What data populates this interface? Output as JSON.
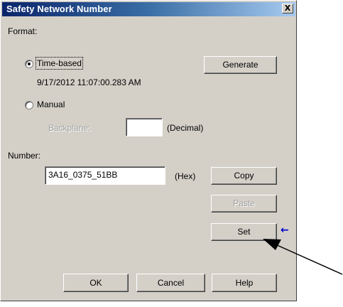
{
  "dialog": {
    "title": "Safety Network Number",
    "close_glyph": "X"
  },
  "format": {
    "group_label": "Format:",
    "time_based": {
      "label": "Time-based",
      "selected": true,
      "timestamp": "9/17/2012 11:07:00.283 AM"
    },
    "manual": {
      "label": "Manual",
      "selected": false,
      "backplane_label": "Backplane:",
      "backplane_value": "",
      "decimal_label": "(Decimal)"
    },
    "generate_label": "Generate"
  },
  "number": {
    "label": "Number:",
    "value": "3A16_0375_51BB",
    "hex_label": "(Hex)"
  },
  "buttons": {
    "copy": "Copy",
    "paste": "Paste",
    "set": "Set",
    "ok": "OK",
    "cancel": "Cancel",
    "help": "Help"
  },
  "annotation": {
    "marker_glyph": "←",
    "colors": {
      "marker": "#0000cc",
      "pointer_arrow": "#000000"
    }
  },
  "colors": {
    "dialog_face": "#d4d0c8",
    "title_gradient_start": "#0a246a",
    "title_gradient_end": "#a6caf0",
    "disabled_text": "#a0a0a0"
  }
}
